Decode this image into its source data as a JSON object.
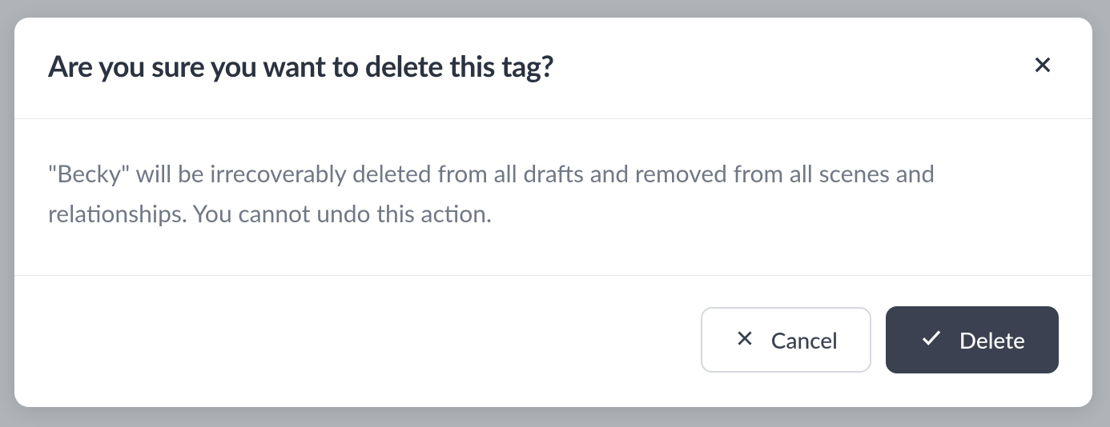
{
  "modal": {
    "title": "Are you sure you want to delete this tag?",
    "message": "\"Becky\" will be irrecoverably deleted from all drafts and removed from all scenes and relationships. You cannot undo this action.",
    "cancel_label": "Cancel",
    "delete_label": "Delete"
  }
}
